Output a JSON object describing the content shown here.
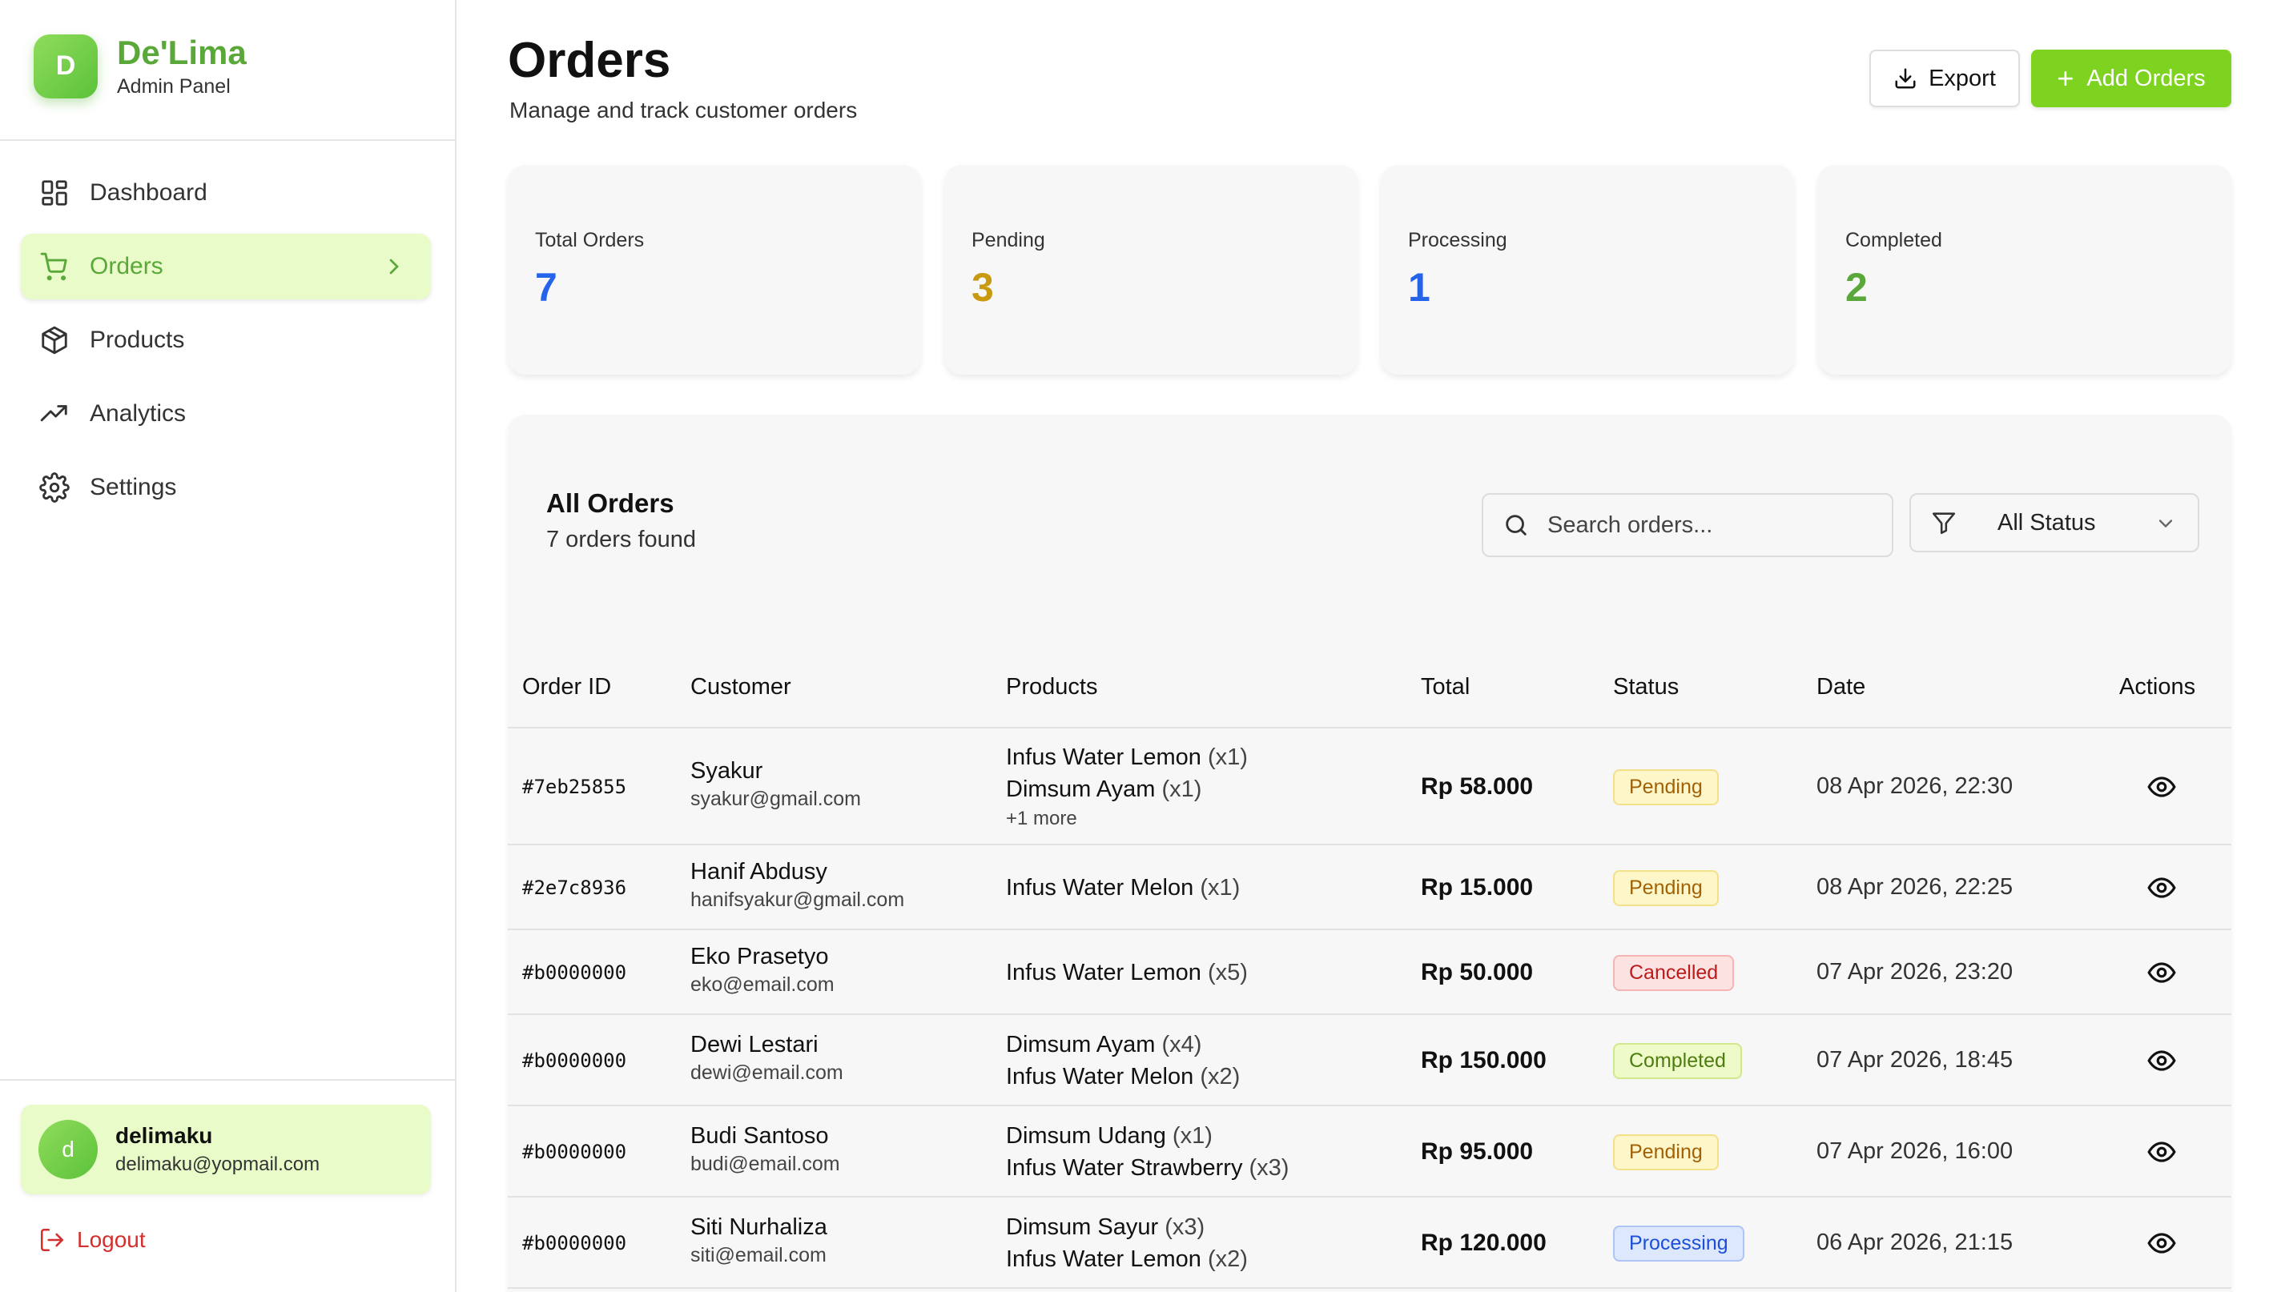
{
  "brand": {
    "initial": "D",
    "name": "De'Lima",
    "subtitle": "Admin Panel"
  },
  "nav": {
    "dashboard": "Dashboard",
    "orders": "Orders",
    "products": "Products",
    "analytics": "Analytics",
    "settings": "Settings"
  },
  "user": {
    "initial": "d",
    "name": "delimaku",
    "email": "delimaku@yopmail.com"
  },
  "logout_label": "Logout",
  "header": {
    "title": "Orders",
    "subtitle": "Manage and track customer orders",
    "export_label": "Export",
    "add_plus": "+",
    "add_label": "Add Orders"
  },
  "stats": {
    "total": {
      "label": "Total Orders",
      "value": "7",
      "color": "#2563eb"
    },
    "pending": {
      "label": "Pending",
      "value": "3",
      "color": "#c99a0f"
    },
    "processing": {
      "label": "Processing",
      "value": "1",
      "color": "#2563eb"
    },
    "completed": {
      "label": "Completed",
      "value": "2",
      "color": "#5aa83a"
    }
  },
  "orders_panel": {
    "title": "All Orders",
    "subtitle": "7 orders found",
    "search_placeholder": "Search orders...",
    "status_filter": "All Status"
  },
  "table": {
    "headers": {
      "order_id": "Order ID",
      "customer": "Customer",
      "products": "Products",
      "total": "Total",
      "status": "Status",
      "date": "Date",
      "actions": "Actions"
    },
    "rows": [
      {
        "id": "#7eb25855",
        "name": "Syakur",
        "email": "syakur@gmail.com",
        "products": [
          {
            "name": "Infus Water Lemon",
            "qty": "(x1)"
          },
          {
            "name": "Dimsum Ayam",
            "qty": "(x1)"
          }
        ],
        "more": "+1 more",
        "total": "Rp 58.000",
        "status": "Pending",
        "date": "08 Apr 2026, 22:30"
      },
      {
        "id": "#2e7c8936",
        "name": "Hanif Abdusy",
        "email": "hanifsyakur@gmail.com",
        "products": [
          {
            "name": "Infus Water Melon",
            "qty": "(x1)"
          }
        ],
        "total": "Rp 15.000",
        "status": "Pending",
        "date": "08 Apr 2026, 22:25"
      },
      {
        "id": "#b0000000",
        "name": "Eko Prasetyo",
        "email": "eko@email.com",
        "products": [
          {
            "name": "Infus Water Lemon",
            "qty": "(x5)"
          }
        ],
        "total": "Rp 50.000",
        "status": "Cancelled",
        "date": "07 Apr 2026, 23:20"
      },
      {
        "id": "#b0000000",
        "name": "Dewi Lestari",
        "email": "dewi@email.com",
        "products": [
          {
            "name": "Dimsum Ayam",
            "qty": "(x4)"
          },
          {
            "name": "Infus Water Melon",
            "qty": "(x2)"
          }
        ],
        "total": "Rp 150.000",
        "status": "Completed",
        "date": "07 Apr 2026, 18:45"
      },
      {
        "id": "#b0000000",
        "name": "Budi Santoso",
        "email": "budi@email.com",
        "products": [
          {
            "name": "Dimsum Udang",
            "qty": "(x1)"
          },
          {
            "name": "Infus Water Strawberry",
            "qty": "(x3)"
          }
        ],
        "total": "Rp 95.000",
        "status": "Pending",
        "date": "07 Apr 2026, 16:00"
      },
      {
        "id": "#b0000000",
        "name": "Siti Nurhaliza",
        "email": "siti@email.com",
        "products": [
          {
            "name": "Dimsum Sayur",
            "qty": "(x3)"
          },
          {
            "name": "Infus Water Lemon",
            "qty": "(x2)"
          }
        ],
        "total": "Rp 120.000",
        "status": "Processing",
        "date": "06 Apr 2026, 21:15"
      }
    ]
  },
  "status_colors": {
    "Pending": {
      "bg": "#fdf6c9",
      "border": "#f3e18a",
      "text": "#a16207"
    },
    "Cancelled": {
      "bg": "#fde2e2",
      "border": "#f5b5b5",
      "text": "#b91c1c"
    },
    "Completed": {
      "bg": "#eefbc9",
      "border": "#cfe98c",
      "text": "#4d7c0f"
    },
    "Processing": {
      "bg": "#dde8fd",
      "border": "#adc4f5",
      "text": "#1d4ed8"
    }
  },
  "colors": {
    "accent": "#7ed321",
    "brand_green": "#5aa83a",
    "danger": "#d32f2f"
  }
}
